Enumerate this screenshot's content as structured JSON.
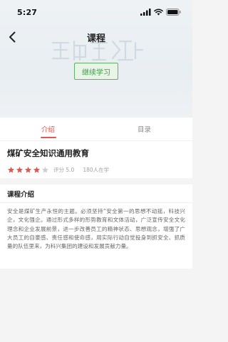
{
  "status_bar": {
    "time": "5:27",
    "icons": [
      "signal-icon",
      "wifi-icon",
      "battery-icon"
    ]
  },
  "nav": {
    "title": "课程",
    "back_icon": "chevron-left-icon"
  },
  "hero": {
    "continue_label": "继续学习"
  },
  "tabs": [
    {
      "label": "介绍",
      "active": true
    },
    {
      "label": "目录",
      "active": false
    }
  ],
  "course": {
    "title": "煤矿安全知识通用教育",
    "rating_stars": 4,
    "rating_max": 5,
    "rating_text": "评分 5.0",
    "learners_text": "180人在学"
  },
  "intro": {
    "heading": "课程介绍",
    "body": "安全是煤矿生产永恒的主题。必须坚持“安全第一的思想不动摇，科技兴企，文化强企。通过形式多样的形势教育和文体活动，广泛宣传安全文化理念和企业发展前景，进一步改善员工的精神状态、思想观念，增强了广大员工的自豪感、责任感和使命感，用实际行动自觉投身到抓安全、抓质量的队伍里来，为科兴集团的建设和发展贡献力量。"
  },
  "colors": {
    "accent": "#e2574c",
    "star_on": "#e2574c",
    "star_off": "#cfcfcf",
    "button_green": "#3c9a45"
  }
}
